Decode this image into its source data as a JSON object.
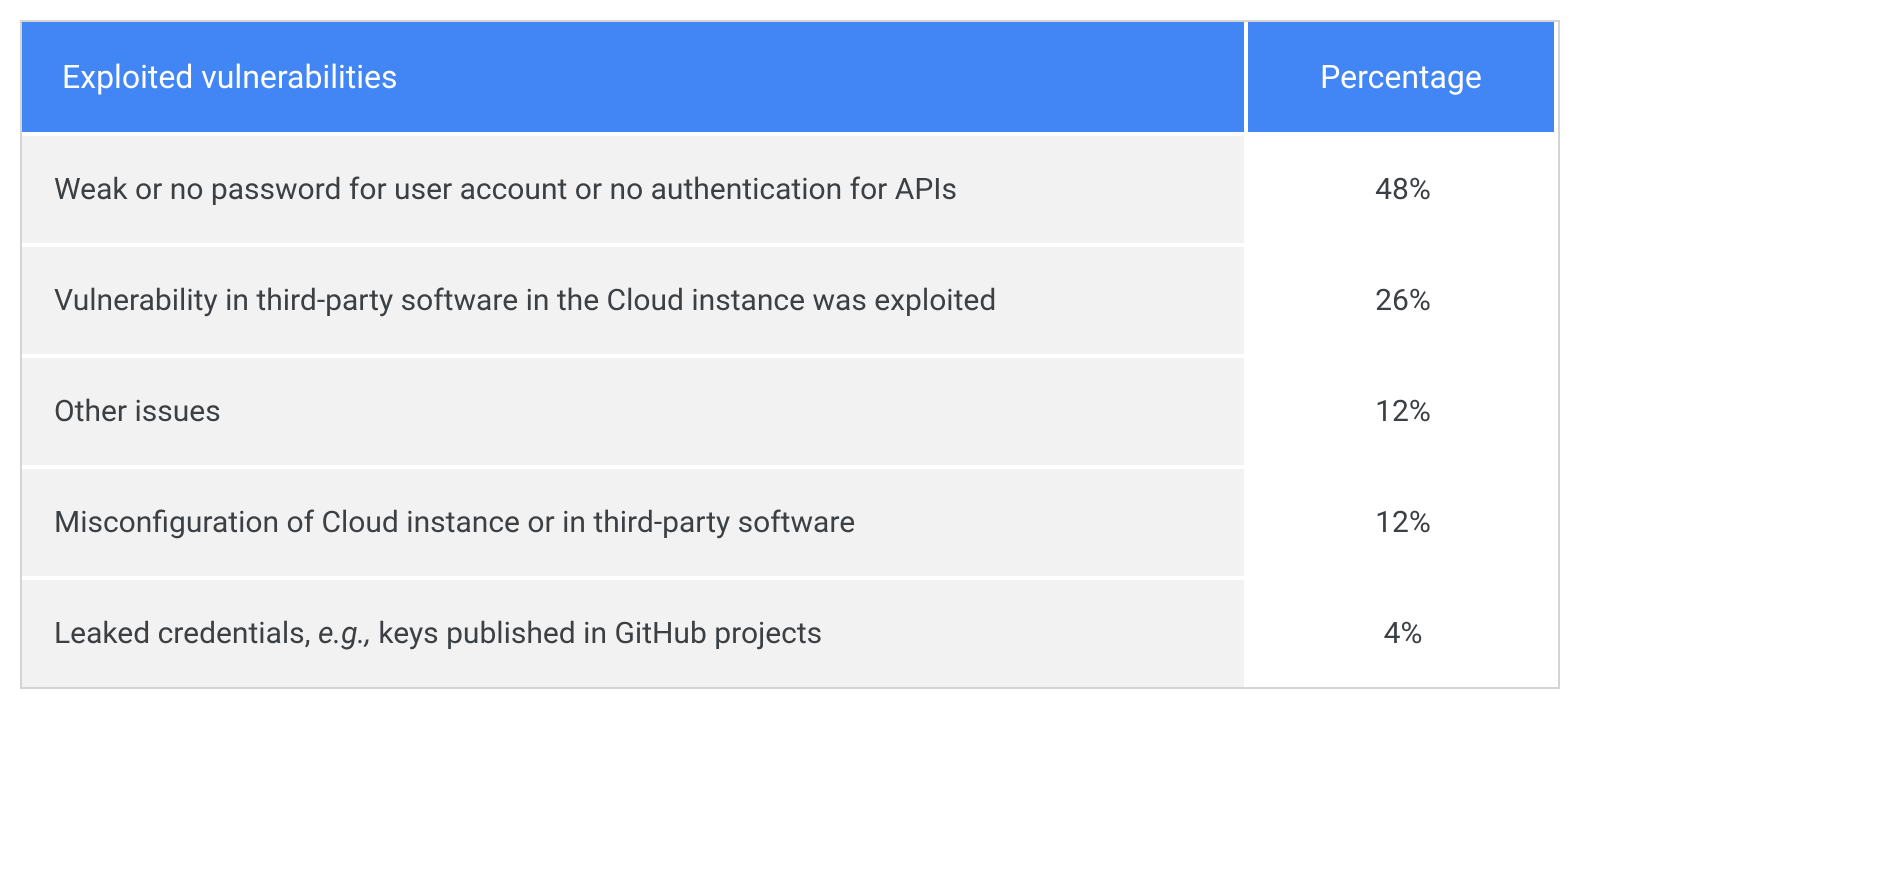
{
  "chart_data": {
    "type": "table",
    "columns": [
      "Exploited vulnerabilities",
      "Percentage"
    ],
    "rows": [
      {
        "vulnerability": "Weak or no password for user account or no authentication for APIs",
        "percentage": "48%"
      },
      {
        "vulnerability": "Vulnerability in third-party software in the Cloud instance was exploited",
        "percentage": "26%"
      },
      {
        "vulnerability": "Other issues",
        "percentage": "12%"
      },
      {
        "vulnerability": "Misconfiguration of Cloud instance or in third-party software",
        "percentage": "12%"
      },
      {
        "vulnerability": "Leaked credentials, e.g., keys published in GitHub projects",
        "percentage": "4%"
      }
    ]
  },
  "table": {
    "header": {
      "col1": "Exploited vulnerabilities",
      "col2": "Percentage"
    },
    "rows": [
      {
        "desc": "Weak or no password for user account or no authentication for APIs",
        "pct": "48%"
      },
      {
        "desc": "Vulnerability in third-party software in the Cloud instance was exploited",
        "pct": "26%"
      },
      {
        "desc": "Other issues",
        "pct": "12%"
      },
      {
        "desc": "Misconfiguration of Cloud instance or in third-party software",
        "pct": "12%"
      },
      {
        "desc_pre": "Leaked credentials, ",
        "desc_em": "e.g.,",
        "desc_post": " keys published in GitHub projects",
        "pct": "4%"
      }
    ]
  }
}
